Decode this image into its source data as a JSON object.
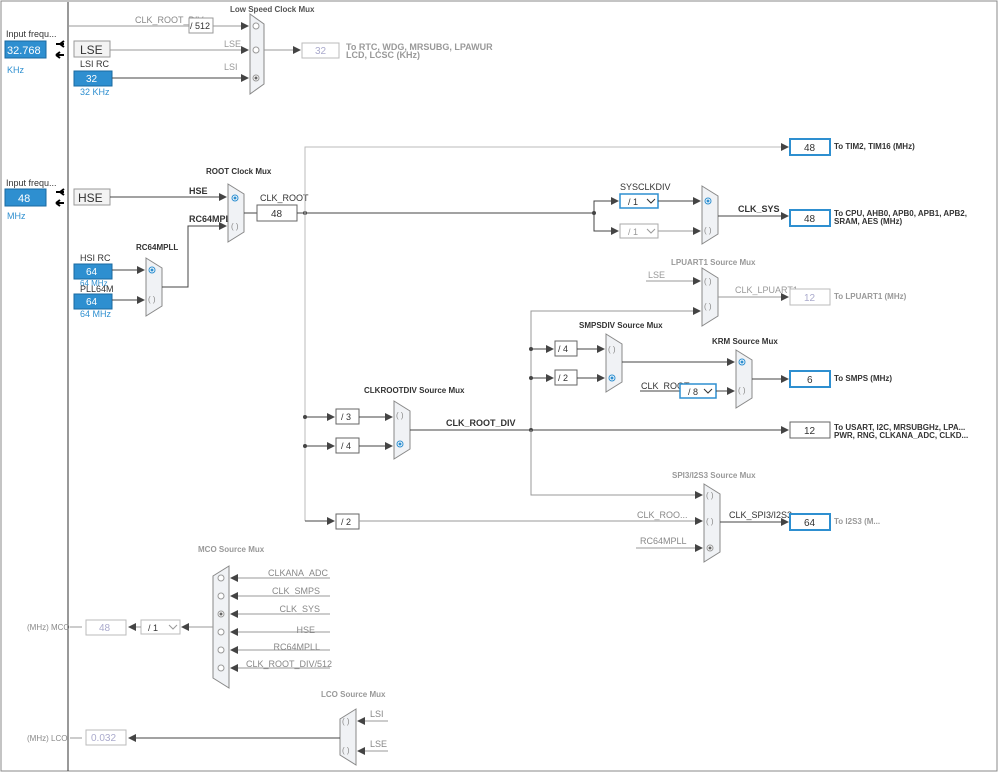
{
  "inputs": {
    "lse": {
      "label": "Input frequ...",
      "value": "32.768",
      "unit": "KHz",
      "name": "LSE"
    },
    "hse": {
      "label": "Input frequ...",
      "value": "48",
      "unit": "MHz",
      "name": "HSE"
    },
    "lsi_rc": {
      "label": "LSI RC",
      "value": "32",
      "unit": "32 KHz"
    },
    "hsi_rc": {
      "label": "HSI RC",
      "value": "64",
      "unit": "64 MHz"
    },
    "pll64m": {
      "label": "PLL64M",
      "value": "64",
      "unit": "64 MHz"
    }
  },
  "muxes": {
    "low_speed": {
      "title": "Low Speed Clock Mux",
      "div_label": "CLK_ROOT_DIV",
      "div_value": "/ 512",
      "in_lse": "LSE",
      "in_lsi": "LSI"
    },
    "root": {
      "title": "ROOT Clock Mux",
      "in_hse": "HSE",
      "in_rc64": "RC64MPLL",
      "out_label": "CLK_ROOT",
      "out_value": "48"
    },
    "rc64mpll": {
      "title": "RC64MPLL"
    },
    "sysclkdiv": {
      "title": "SYSCLKDIV",
      "div1": "/ 1",
      "div2": "/ 1",
      "out_label": "CLK_SYS"
    },
    "lpuart": {
      "title": "LPUART1 Source Mux",
      "in_lse": "LSE",
      "in_clk": "CLK_LPUART1"
    },
    "smpsdiv": {
      "title": "SMPSDIV Source Mux",
      "div4": "/ 4",
      "div2": "/ 2"
    },
    "krm": {
      "title": "KRM Source Mux",
      "in_label": "CLK_ROOT",
      "div": "/ 8"
    },
    "clkrootdiv": {
      "title": "CLKROOTDIV Source Mux",
      "div3": "/ 3",
      "div4": "/ 4",
      "out_label": "CLK_ROOT_DIV"
    },
    "spi": {
      "title": "SPI3/I2S3 Source Mux",
      "in1": "CLK_ROO...",
      "in2": "RC64MPLL",
      "out_label": "CLK_SPI3/I2S3",
      "div2": "/ 2"
    },
    "mco": {
      "title": "MCO Source Mux",
      "inputs": [
        "CLKANA_ADC",
        "CLK_SMPS",
        "CLK_SYS",
        "HSE",
        "RC64MPLL",
        "CLK_ROOT_DIV/512"
      ],
      "out_label": "(MHz) MCO",
      "out_value": "48",
      "div": "/ 1"
    },
    "lco": {
      "title": "LCO Source Mux",
      "in_lsi": "LSI",
      "in_lse": "LSE",
      "out_label": "(MHz) LCO",
      "out_value": "0.032"
    }
  },
  "outputs": [
    {
      "value": "32",
      "label1": "To RTC, WDG, MRSUBG, LPAWUR",
      "label2": "LCD, LCSC (KHz)"
    },
    {
      "value": "48",
      "label1": "To TIM2, TIM16 (MHz)",
      "label2": ""
    },
    {
      "value": "48",
      "label1": "To CPU, AHB0, APB0, APB1, APB2,",
      "label2": "SRAM, AES (MHz)"
    },
    {
      "value": "12",
      "label1": "To LPUART1 (MHz)",
      "label2": ""
    },
    {
      "value": "6",
      "label1": "To SMPS (MHz)",
      "label2": ""
    },
    {
      "value": "12",
      "label1": "To USART, I2C, MRSUBGHz, LPA...",
      "label2": "PWR, RNG, CLKANA_ADC, CLKD..."
    },
    {
      "value": "64",
      "label1": "To I2S3 (M...",
      "label2": ""
    }
  ],
  "colors": {
    "accent": "#2e8fd0",
    "line": "#555555",
    "grey": "#999999",
    "box_border": "#2e8fd0",
    "mux_fill": "#f0f2f5"
  }
}
